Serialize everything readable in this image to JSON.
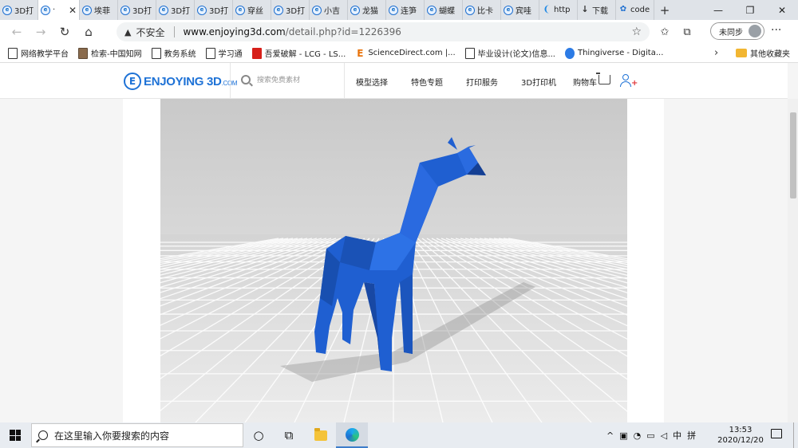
{
  "browser": {
    "tabs": [
      {
        "label": "3D打",
        "icon": "site-icon"
      },
      {
        "label": "·",
        "icon": "site-icon",
        "active": true,
        "close": "✕"
      },
      {
        "label": "埃菲",
        "icon": "site-icon"
      },
      {
        "label": "3D打",
        "icon": "site-icon"
      },
      {
        "label": "3D打",
        "icon": "site-icon"
      },
      {
        "label": "3D打",
        "icon": "site-icon"
      },
      {
        "label": "穿丝",
        "icon": "site-icon"
      },
      {
        "label": "3D打",
        "icon": "site-icon"
      },
      {
        "label": "小吉",
        "icon": "site-icon"
      },
      {
        "label": "龙猫",
        "icon": "site-icon"
      },
      {
        "label": "连笋",
        "icon": "site-icon"
      },
      {
        "label": "蝴蝶",
        "icon": "site-icon"
      },
      {
        "label": "比卡",
        "icon": "site-icon"
      },
      {
        "label": "宾哇",
        "icon": "site-icon"
      },
      {
        "label": "http",
        "icon": "twitter-icon"
      },
      {
        "label": "下载",
        "icon": "download-icon"
      },
      {
        "label": "code",
        "icon": "paw-icon"
      }
    ],
    "new_tab": "+",
    "window_controls": {
      "minimize": "—",
      "restore": "❐",
      "close": "✕"
    },
    "nav": {
      "back": "←",
      "forward": "→",
      "refresh": "↻",
      "home": "⌂"
    },
    "address": {
      "warning_icon": "▲",
      "insecure": "不安全",
      "host": "www.enjoying3d.com",
      "path": "/detail.php?id=1226396"
    },
    "favorite_star": "☆",
    "sync_label": "未同步",
    "more": "···",
    "bookmarks": [
      {
        "label": "网络教学平台",
        "icon": "doc"
      },
      {
        "label": "检索-中国知网",
        "icon": "img"
      },
      {
        "label": "教务系统",
        "icon": "doc"
      },
      {
        "label": "学习通",
        "icon": "doc"
      },
      {
        "label": "吾爱破解 - LCG - LS...",
        "icon": "red"
      },
      {
        "label": "ScienceDirect.com |...",
        "icon": "orange"
      },
      {
        "label": "毕业设计(论文)信息...",
        "icon": "doc"
      },
      {
        "label": "Thingiverse - Digita...",
        "icon": "circle"
      }
    ],
    "bookmarks_more": "›",
    "other_bookmarks": "其他收藏夹"
  },
  "site": {
    "logo_letter": "E",
    "logo_text": "ENJOYING 3D",
    "logo_suffix": ".COM",
    "search_placeholder": "搜索免费素材",
    "nav": [
      "模型选择",
      "特色专题",
      "打印服务",
      "3D打印机",
      "购物车"
    ],
    "login_mark": "+"
  },
  "taskbar": {
    "search_placeholder": "在这里输入你要搜索的内容",
    "tray": {
      "chevron": "^",
      "ime": "中",
      "keyboard": "拼"
    },
    "time": "13:53",
    "date": "2020/12/20"
  },
  "colors": {
    "brand": "#1e72d6",
    "model": "#1f5fd1",
    "taskbar": "#e8ecf1"
  }
}
